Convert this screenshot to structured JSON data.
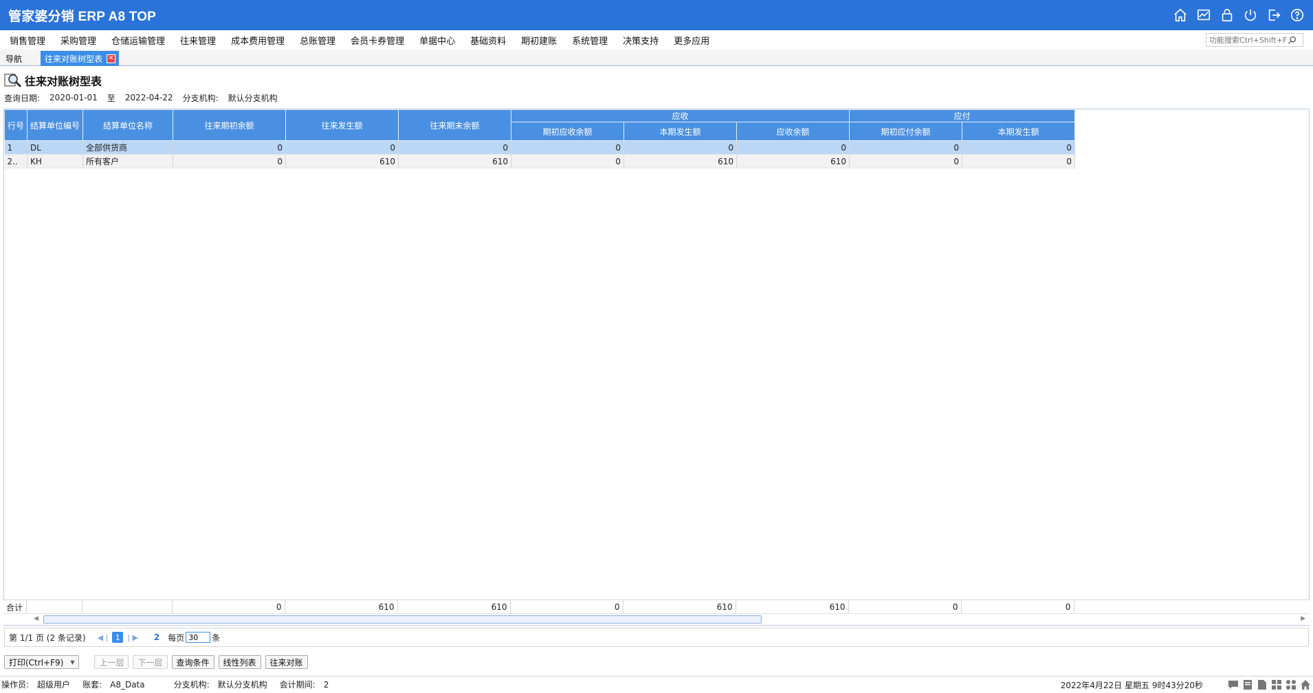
{
  "app": {
    "title": "管家婆分销 ERP A8 TOP"
  },
  "titlebar_icons": [
    "home-icon",
    "chart-icon",
    "lock-icon",
    "power-icon",
    "logout-icon",
    "help-icon"
  ],
  "menu": [
    "销售管理",
    "采购管理",
    "仓储运输管理",
    "往来管理",
    "成本费用管理",
    "总账管理",
    "会员卡券管理",
    "单据中心",
    "基础资料",
    "期初建账",
    "系统管理",
    "决策支持",
    "更多应用"
  ],
  "search": {
    "placeholder": "功能搜索Ctrl+Shift+F"
  },
  "tabs": {
    "nav": "导航",
    "active": "往来对账树型表"
  },
  "report": {
    "title": "往来对账树型表",
    "query_date_label": "查询日期:",
    "date_from": "2020-01-01",
    "to_label": "至",
    "date_to": "2022-04-22",
    "branch_label": "分支机构:",
    "branch_value": "默认分支机构"
  },
  "grid": {
    "headers": {
      "row_no": "行号",
      "code": "结算单位编号",
      "name": "结算单位名称",
      "opening": "往来期初余额",
      "occurred": "往来发生额",
      "closing": "往来期末余额",
      "receivable_group": "应收",
      "recv_opening": "期初应收余额",
      "recv_current": "本期发生额",
      "recv_balance": "应收余额",
      "payable_group": "应付",
      "pay_opening": "期初应付余额",
      "pay_current": "本期发生额"
    },
    "rows": [
      {
        "no": "1",
        "code": "DL",
        "name": "全部供货商",
        "opening": "0",
        "occurred": "0",
        "closing": "0",
        "recv_opening": "0",
        "recv_current": "0",
        "recv_balance": "0",
        "pay_opening": "0",
        "pay_current": "0"
      },
      {
        "no": "2..",
        "code": "KH",
        "name": "所有客户",
        "opening": "0",
        "occurred": "610",
        "closing": "610",
        "recv_opening": "0",
        "recv_current": "610",
        "recv_balance": "610",
        "pay_opening": "0",
        "pay_current": "0"
      }
    ],
    "totals": {
      "label": "合计",
      "opening": "0",
      "occurred": "610",
      "closing": "610",
      "recv_opening": "0",
      "recv_current": "610",
      "recv_balance": "610",
      "pay_opening": "0",
      "pay_current": "0"
    }
  },
  "pager": {
    "page_info": "第  1/1 页  (2 条记录)",
    "current_page": "1",
    "next_page_link": "2",
    "per_page_label": "每页",
    "per_page_value": "30",
    "unit": "条"
  },
  "toolbar": {
    "print": "打印(Ctrl+F9)",
    "up": "上一层",
    "down": "下一层",
    "query": "查询条件",
    "linear": "线性列表",
    "reconcile": "往来对账"
  },
  "status": {
    "operator_label": "操作员:",
    "operator": "超级用户",
    "account_label": "账套:",
    "account": "A8_Data",
    "branch_label": "分支机构:",
    "branch": "默认分支机构",
    "period_label": "会计期间:",
    "period": "2",
    "datetime": "2022年4月22日  星期五  9时43分20秒"
  }
}
